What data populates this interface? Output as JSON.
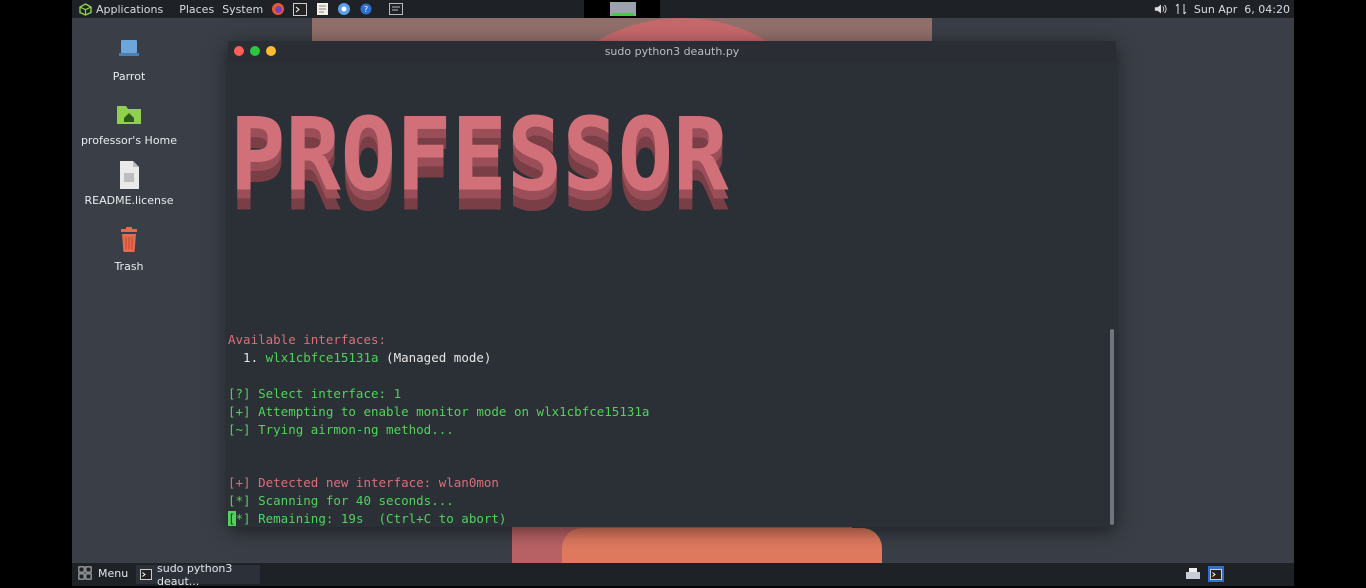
{
  "top_panel": {
    "applications": "Applications",
    "places": "Places",
    "system": "System",
    "datetime": "Sun Apr  6, 04:20"
  },
  "desktop": {
    "icons": [
      {
        "label": "Parrot"
      },
      {
        "label": "professor's Home"
      },
      {
        "label": "README.license"
      },
      {
        "label": "Trash"
      }
    ]
  },
  "terminal": {
    "title": "sudo python3 deauth.py",
    "banner": "PROFESSOR",
    "lines": {
      "l1": "Available interfaces:",
      "l2_num": "  1. ",
      "l2_iface": "wlx1cbfce15131a",
      "l2_mode": " (Managed mode)",
      "l3": "[?] Select interface: 1",
      "l4": "[+] Attempting to enable monitor mode on wlx1cbfce15131a",
      "l5": "[~] Trying airmon-ng method...",
      "l6": "[+] Detected new interface: wlan0mon",
      "l7": "[*] Scanning for 40 seconds...",
      "l8_cursor": "[",
      "l8_rest": "*] Remaining: 19s  (Ctrl+C to abort)"
    }
  },
  "bottom_panel": {
    "menu": "Menu",
    "task": "sudo python3 deaut..."
  },
  "colors": {
    "accent_red": "#d96f79",
    "accent_green": "#4fd45a"
  }
}
